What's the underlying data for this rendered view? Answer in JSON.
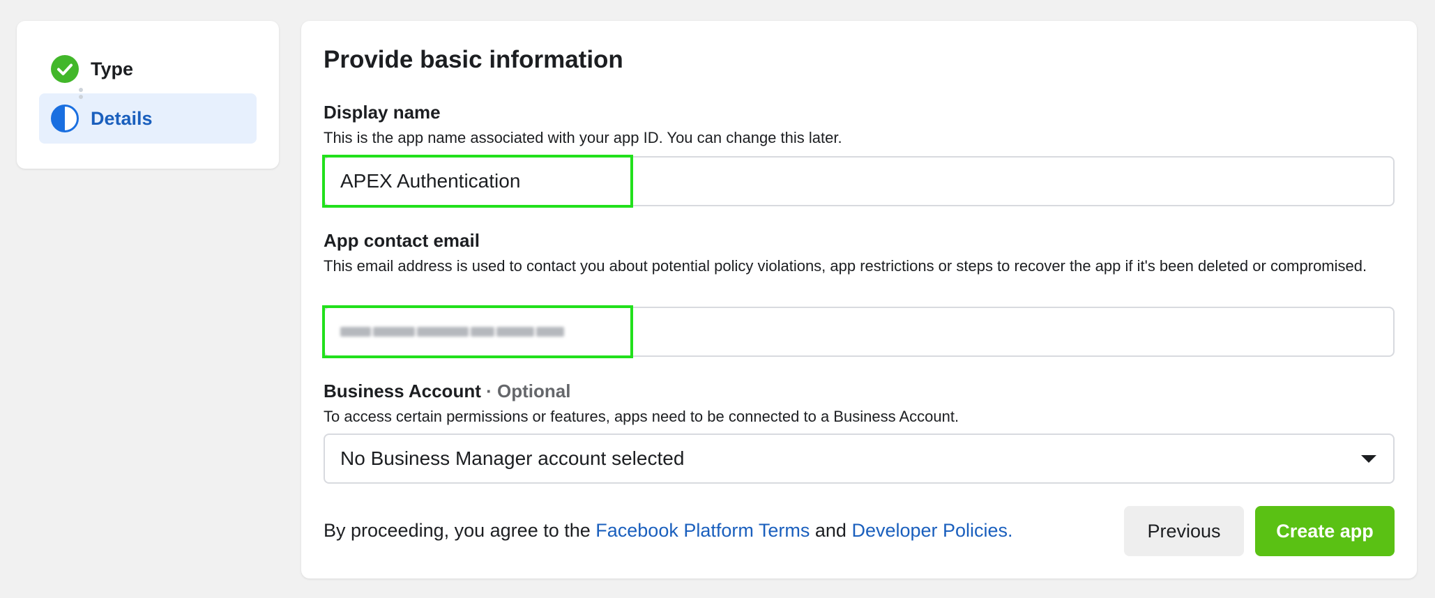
{
  "stepper": {
    "steps": [
      {
        "label": "Type",
        "status": "complete",
        "icon": "check-circle-icon"
      },
      {
        "label": "Details",
        "status": "in-progress",
        "icon": "half-circle-icon"
      }
    ]
  },
  "form": {
    "title": "Provide basic information",
    "display_name": {
      "label": "Display name",
      "help": "This is the app name associated with your app ID. You can change this later.",
      "value": "APEX Authentication"
    },
    "contact_email": {
      "label": "App contact email",
      "help": "This email address is used to contact you about potential policy violations, app restrictions or steps to recover the app if it's been deleted or compromised."
    },
    "business_account": {
      "label": "Business Account",
      "optional": " · Optional",
      "help": "To access certain permissions or features, apps need to be connected to a Business Account.",
      "selected": "No Business Manager account selected"
    },
    "footer": {
      "prefix": "By proceeding, you agree to the ",
      "terms_link": "Facebook Platform Terms",
      "middle": " and ",
      "policies_link": "Developer Policies."
    },
    "buttons": {
      "previous": "Previous",
      "create": "Create app"
    }
  },
  "colors": {
    "accent_blue": "#1a5fbd",
    "success_green": "#42b72a",
    "create_button": "#5ac114",
    "highlight": "#22e01c",
    "active_step_bg": "#e7f0fd"
  }
}
